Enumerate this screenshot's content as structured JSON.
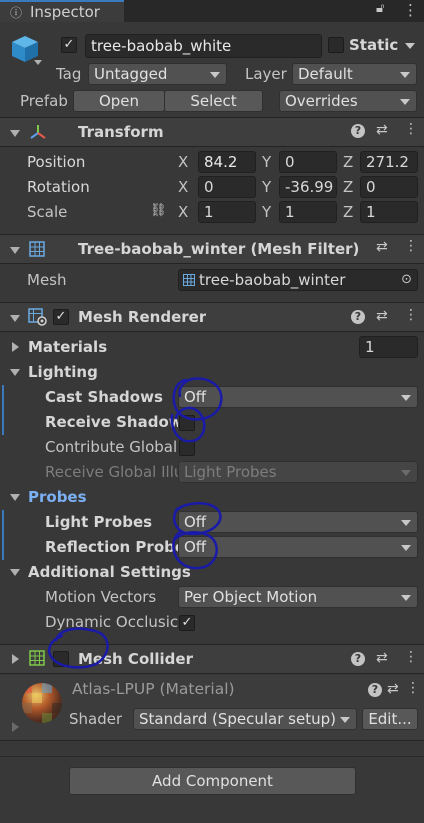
{
  "tab": {
    "title": "Inspector"
  },
  "header": {
    "active_checked": true,
    "object_name": "tree-baobab_white",
    "static_label": "Static",
    "tag_label": "Tag",
    "tag_value": "Untagged",
    "layer_label": "Layer",
    "layer_value": "Default",
    "prefab_label": "Prefab",
    "open_label": "Open",
    "select_label": "Select",
    "overrides_label": "Overrides"
  },
  "transform": {
    "title": "Transform",
    "position_label": "Position",
    "rotation_label": "Rotation",
    "scale_label": "Scale",
    "axes": {
      "x": "X",
      "y": "Y",
      "z": "Z"
    },
    "position": {
      "x": "84.2",
      "y": "0",
      "z": "271.2"
    },
    "rotation": {
      "x": "0",
      "y": "-36.99",
      "z": "0"
    },
    "scale": {
      "x": "1",
      "y": "1",
      "z": "1"
    }
  },
  "mesh_filter": {
    "title": "Tree-baobab_winter (Mesh Filter)",
    "mesh_label": "Mesh",
    "mesh_value": "tree-baobab_winter"
  },
  "mesh_renderer": {
    "title": "Mesh Renderer",
    "enabled": true,
    "materials_label": "Materials",
    "materials_count": "1",
    "lighting_label": "Lighting",
    "cast_shadows_label": "Cast Shadows",
    "cast_shadows_value": "Off",
    "receive_shadows_label": "Receive Shadows",
    "contribute_global_label": "Contribute Global",
    "receive_global_label": "Receive Global Illu",
    "receive_global_value": "Light Probes",
    "probes_label": "Probes",
    "light_probes_label": "Light Probes",
    "light_probes_value": "Off",
    "reflection_probes_label": "Reflection Probes",
    "reflection_probes_value": "Off",
    "additional_label": "Additional Settings",
    "motion_vectors_label": "Motion Vectors",
    "motion_vectors_value": "Per Object Motion",
    "dynamic_occlusion_label": "Dynamic Occlusic",
    "dynamic_occlusion_checked": true
  },
  "mesh_collider": {
    "title": "Mesh Collider"
  },
  "material": {
    "name": "Atlas-LPUP (Material)",
    "shader_label": "Shader",
    "shader_value": "Standard (Specular setup)",
    "edit_label": "Edit..."
  },
  "footer": {
    "add_component_label": "Add Component"
  },
  "colors": {
    "accent_blue": "#7cb0f5",
    "ink_annotation": "#1a1aa8",
    "header_bg": "#3e3e3e",
    "panel_bg": "#383838"
  }
}
